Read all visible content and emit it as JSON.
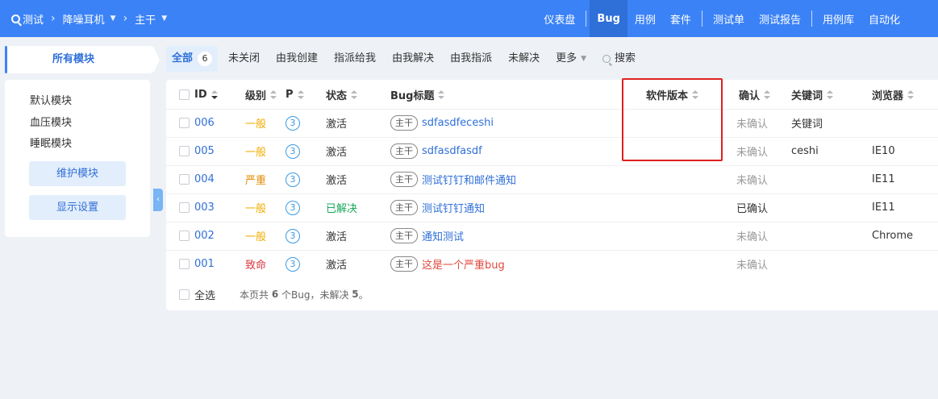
{
  "topbar": {
    "crumbs": [
      {
        "label": "测试",
        "has_caret": false
      },
      {
        "label": "降噪耳机",
        "has_caret": true
      },
      {
        "label": "主干",
        "has_caret": true
      }
    ],
    "nav": [
      {
        "label": "仪表盘",
        "active": false
      },
      {
        "label": "Bug",
        "active": true
      },
      {
        "label": "用例",
        "active": false
      },
      {
        "label": "套件",
        "active": false
      },
      {
        "label": "测试单",
        "active": false
      },
      {
        "label": "测试报告",
        "active": false
      },
      {
        "label": "用例库",
        "active": false
      },
      {
        "label": "自动化",
        "active": false
      }
    ]
  },
  "sidebar": {
    "title": "所有模块",
    "modules": [
      "默认模块",
      "血压模块",
      "睡眠模块"
    ],
    "maintain_button": "维护模块",
    "display_button": "显示设置"
  },
  "tabs": [
    {
      "label": "全部",
      "count": "6",
      "active": true
    },
    {
      "label": "未关闭"
    },
    {
      "label": "由我创建"
    },
    {
      "label": "指派给我"
    },
    {
      "label": "由我解决"
    },
    {
      "label": "由我指派"
    },
    {
      "label": "未解决"
    },
    {
      "label": "更多",
      "dropdown": true
    },
    {
      "label": "搜索",
      "search": true
    }
  ],
  "table": {
    "headers": {
      "id": "ID",
      "level": "级别",
      "pri": "P",
      "status": "状态",
      "title": "Bug标题",
      "version": "软件版本",
      "confirm": "确认",
      "keywords": "关键词",
      "browser": "浏览器"
    },
    "rows": [
      {
        "id": "006",
        "level": "一般",
        "pri": "3",
        "status": "激活",
        "branch": "主干",
        "title": "sdfasdfeceshi",
        "version": "",
        "confirm": "未确认",
        "keywords": "关键词",
        "browser": ""
      },
      {
        "id": "005",
        "level": "一般",
        "pri": "3",
        "status": "激活",
        "branch": "主干",
        "title": "sdfasdfasdf",
        "version": "",
        "confirm": "未确认",
        "keywords": "ceshi",
        "browser": "IE10"
      },
      {
        "id": "004",
        "level": "严重",
        "pri": "3",
        "status": "激活",
        "branch": "主干",
        "title": "测试钉钉和邮件通知",
        "version": "",
        "confirm": "未确认",
        "keywords": "",
        "browser": "IE11"
      },
      {
        "id": "003",
        "level": "一般",
        "pri": "3",
        "status": "已解决",
        "branch": "主干",
        "title": "测试钉钉通知",
        "version": "",
        "confirm": "已确认",
        "keywords": "",
        "browser": "IE11"
      },
      {
        "id": "002",
        "level": "一般",
        "pri": "3",
        "status": "激活",
        "branch": "主干",
        "title": "通知测试",
        "version": "",
        "confirm": "未确认",
        "keywords": "",
        "browser": "Chrome"
      },
      {
        "id": "001",
        "level": "致命",
        "pri": "3",
        "status": "激活",
        "branch": "主干",
        "title": "这是一个严重bug",
        "version": "",
        "confirm": "未确认",
        "keywords": "",
        "browser": ""
      }
    ],
    "footer": {
      "select_all": "全选",
      "summary_prefix": "本页共 ",
      "summary_count": "6",
      "summary_mid": " 个Bug，未解决 ",
      "summary_unresolved": "5",
      "summary_suffix": "。"
    }
  },
  "colors": {
    "primary": "#3b82f6",
    "level_normal": "#f0ad00",
    "level_serious": "#e68a00",
    "level_fatal": "#d9363e",
    "resolved": "#17a85a",
    "highlight_box": "#e02020"
  }
}
